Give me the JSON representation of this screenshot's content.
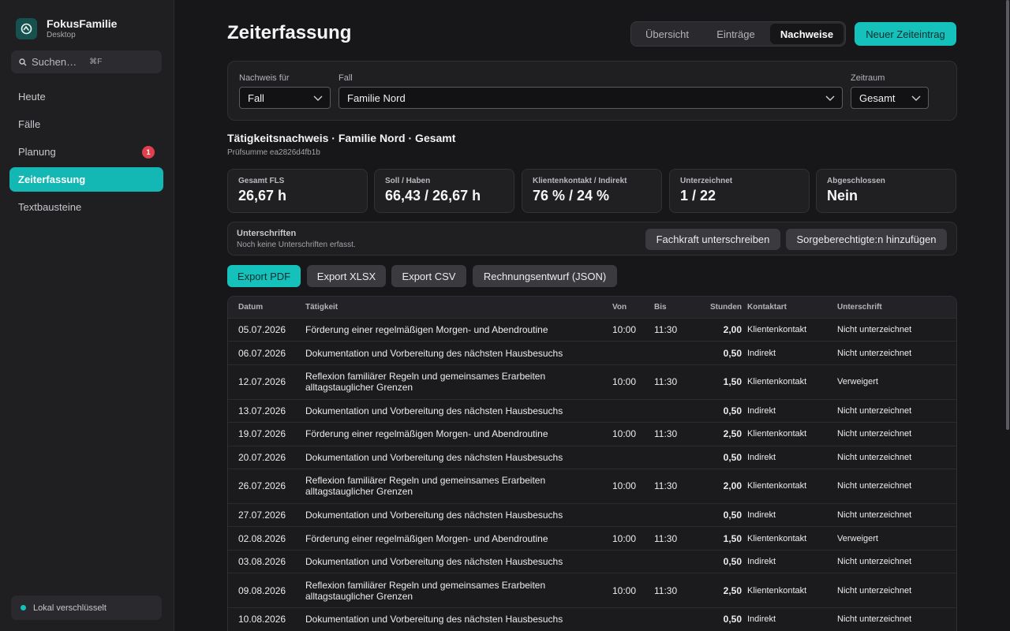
{
  "app": {
    "name": "FokusFamilie",
    "subtitle": "Desktop"
  },
  "search": {
    "placeholder": "Suchen…",
    "shortcut": "⌘F"
  },
  "sidebar": {
    "items": [
      {
        "label": "Heute"
      },
      {
        "label": "Fälle"
      },
      {
        "label": "Planung",
        "badge": "1"
      },
      {
        "label": "Zeiterfassung",
        "active": true
      },
      {
        "label": "Textbausteine"
      }
    ],
    "footer": "Lokal verschlüsselt"
  },
  "header": {
    "title": "Zeiterfassung",
    "tabs": [
      "Übersicht",
      "Einträge",
      "Nachweise"
    ],
    "active_tab": "Nachweise",
    "new_entry_label": "Neuer Zeiteintrag"
  },
  "filters": {
    "nachweis_label": "Nachweis für",
    "nachweis_value": "Fall",
    "fall_label": "Fall",
    "fall_value": "Familie Nord",
    "zeitraum_label": "Zeitraum",
    "zeitraum_value": "Gesamt"
  },
  "report": {
    "title": "Tätigkeitsnachweis · Familie Nord · Gesamt",
    "checksum": "Prüfsumme ea2826d4fb1b"
  },
  "stats": [
    {
      "label": "Gesamt FLS",
      "value": "26,67 h"
    },
    {
      "label": "Soll / Haben",
      "value": "66,43 / 26,67 h"
    },
    {
      "label": "Klientenkontakt / Indirekt",
      "value": "76 % / 24 %"
    },
    {
      "label": "Unterzeichnet",
      "value": "1 / 22"
    },
    {
      "label": "Abgeschlossen",
      "value": "Nein"
    }
  ],
  "signatures": {
    "title": "Unterschriften",
    "subtitle": "Noch keine Unterschriften erfasst.",
    "sign_button": "Fachkraft unterschreiben",
    "add_button": "Sorgeberechtigte:n hinzufügen"
  },
  "exports": [
    "Export PDF",
    "Export XLSX",
    "Export CSV",
    "Rechnungsentwurf (JSON)"
  ],
  "table": {
    "columns": [
      "Datum",
      "Tätigkeit",
      "Von",
      "Bis",
      "Stunden",
      "Kontaktart",
      "Unterschrift"
    ],
    "rows": [
      {
        "date": "05.07.2026",
        "task": "Förderung einer regelmäßigen Morgen- und Abendroutine",
        "from": "10:00",
        "to": "11:30",
        "hours": "2,00",
        "type": "Klientenkontakt",
        "sig": "Nicht unterzeichnet"
      },
      {
        "date": "06.07.2026",
        "task": "Dokumentation und Vorbereitung des nächsten Hausbesuchs",
        "from": "",
        "to": "",
        "hours": "0,50",
        "type": "Indirekt",
        "sig": "Nicht unterzeichnet"
      },
      {
        "date": "12.07.2026",
        "task": "Reflexion familiärer Regeln und gemeinsames Erarbeiten alltagstauglicher Grenzen",
        "from": "10:00",
        "to": "11:30",
        "hours": "1,50",
        "type": "Klientenkontakt",
        "sig": "Verweigert"
      },
      {
        "date": "13.07.2026",
        "task": "Dokumentation und Vorbereitung des nächsten Hausbesuchs",
        "from": "",
        "to": "",
        "hours": "0,50",
        "type": "Indirekt",
        "sig": "Nicht unterzeichnet"
      },
      {
        "date": "19.07.2026",
        "task": "Förderung einer regelmäßigen Morgen- und Abendroutine",
        "from": "10:00",
        "to": "11:30",
        "hours": "2,50",
        "type": "Klientenkontakt",
        "sig": "Nicht unterzeichnet"
      },
      {
        "date": "20.07.2026",
        "task": "Dokumentation und Vorbereitung des nächsten Hausbesuchs",
        "from": "",
        "to": "",
        "hours": "0,50",
        "type": "Indirekt",
        "sig": "Nicht unterzeichnet"
      },
      {
        "date": "26.07.2026",
        "task": "Reflexion familiärer Regeln und gemeinsames Erarbeiten alltagstauglicher Grenzen",
        "from": "10:00",
        "to": "11:30",
        "hours": "2,00",
        "type": "Klientenkontakt",
        "sig": "Nicht unterzeichnet"
      },
      {
        "date": "27.07.2026",
        "task": "Dokumentation und Vorbereitung des nächsten Hausbesuchs",
        "from": "",
        "to": "",
        "hours": "0,50",
        "type": "Indirekt",
        "sig": "Nicht unterzeichnet"
      },
      {
        "date": "02.08.2026",
        "task": "Förderung einer regelmäßigen Morgen- und Abendroutine",
        "from": "10:00",
        "to": "11:30",
        "hours": "1,50",
        "type": "Klientenkontakt",
        "sig": "Verweigert"
      },
      {
        "date": "03.08.2026",
        "task": "Dokumentation und Vorbereitung des nächsten Hausbesuchs",
        "from": "",
        "to": "",
        "hours": "0,50",
        "type": "Indirekt",
        "sig": "Nicht unterzeichnet"
      },
      {
        "date": "09.08.2026",
        "task": "Reflexion familiärer Regeln und gemeinsames Erarbeiten alltagstauglicher Grenzen",
        "from": "10:00",
        "to": "11:30",
        "hours": "2,50",
        "type": "Klientenkontakt",
        "sig": "Nicht unterzeichnet"
      },
      {
        "date": "10.08.2026",
        "task": "Dokumentation und Vorbereitung des nächsten Hausbesuchs",
        "from": "",
        "to": "",
        "hours": "0,50",
        "type": "Indirekt",
        "sig": "Nicht unterzeichnet"
      }
    ]
  },
  "colors": {
    "accent": "#14c1bb",
    "badge": "#e0404e",
    "background": "#171719",
    "sidebar": "#1f1f22"
  }
}
